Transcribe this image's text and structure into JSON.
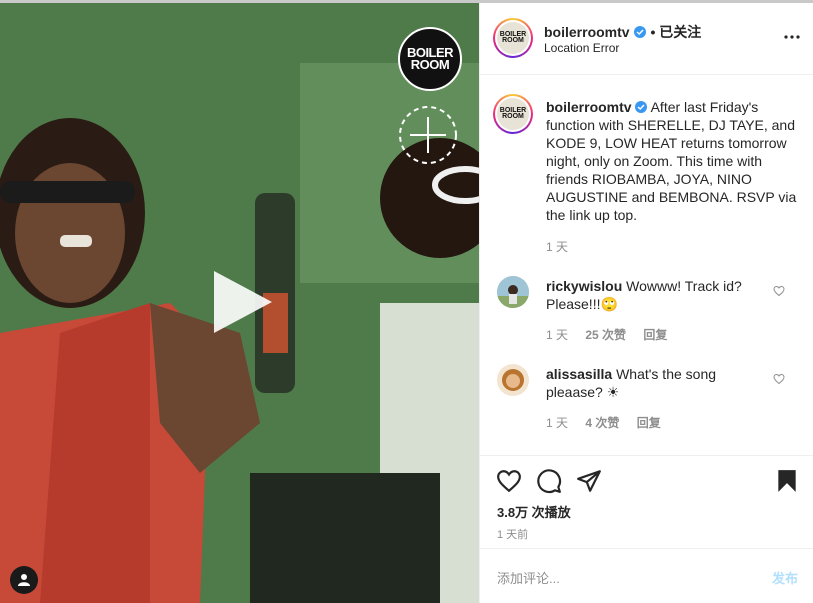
{
  "post": {
    "username": "boilerroomtv",
    "follow_status": "• 已关注",
    "location": "Location Error",
    "more_icon": "more-horizontal-icon",
    "caption_user": "boilerroomtv",
    "caption_text": "After last Friday's function with SHERELLE, DJ TAYE, and KODE 9, LOW HEAT returns tomorrow night, only on Zoom. This time with friends RIOBAMBA, JOYA, NINO AUGUSTINE and BEMBONA. RSVP via the link up top.",
    "caption_time": "1 天"
  },
  "video": {
    "logo_line1": "BOILER",
    "logo_line2": "ROOM"
  },
  "comments": [
    {
      "user": "rickywislou",
      "text": "Wowww! Track id? Please!!!🙄",
      "time": "1 天",
      "likes": "25 次赞",
      "reply": "回复"
    },
    {
      "user": "alissasilla",
      "text": "What's the song pleaase? ☀",
      "time": "1 天",
      "likes": "4 次赞",
      "reply": "回复"
    }
  ],
  "footer": {
    "views": "3.8万 次播放",
    "posted": "1 天前",
    "add_comment_placeholder": "添加评论...",
    "post_button": "发布"
  },
  "colors": {
    "accent": "#0095f6",
    "post_disabled": "#b2dffc",
    "verified": "#3897f0"
  }
}
